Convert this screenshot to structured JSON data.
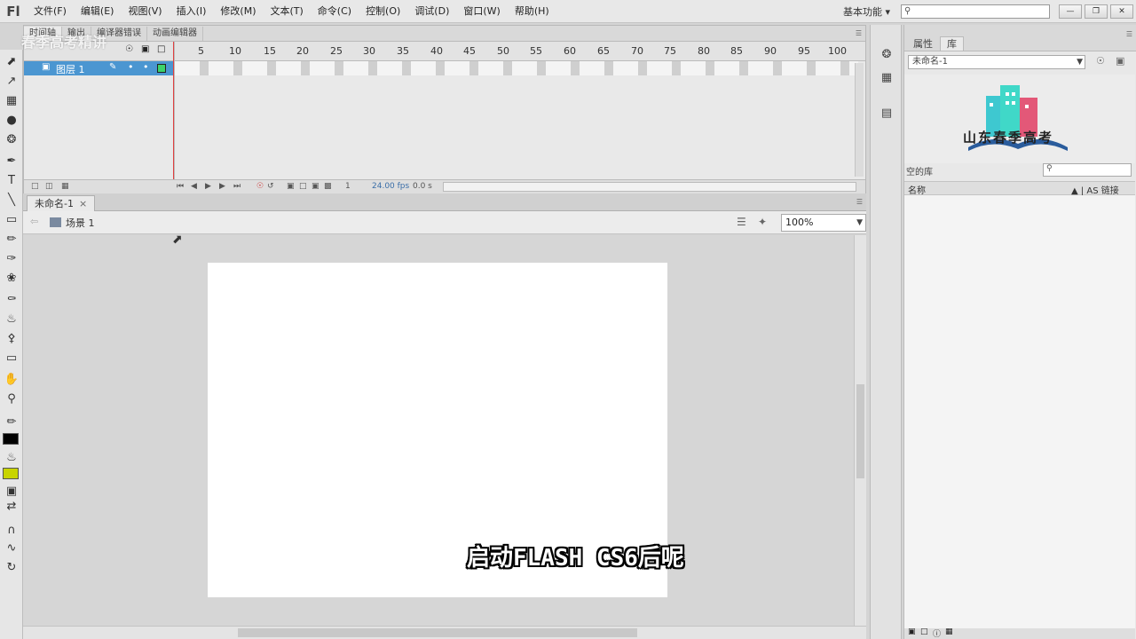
{
  "app": {
    "logo": "Fl",
    "menu": [
      "文件(F)",
      "编辑(E)",
      "视图(V)",
      "插入(I)",
      "修改(M)",
      "文本(T)",
      "命令(C)",
      "控制(O)",
      "调试(D)",
      "窗口(W)",
      "帮助(H)"
    ],
    "workspace": "基本功能",
    "workspace_arrow": "▾",
    "search_placeholder": ""
  },
  "timeline": {
    "tabs": [
      "时间轴",
      "输出",
      "编译器错误",
      "动画编辑器"
    ],
    "frame_numbers": [
      "5",
      "10",
      "15",
      "20",
      "25",
      "30",
      "35",
      "40",
      "45",
      "50",
      "55",
      "60",
      "65",
      "70",
      "75",
      "80",
      "85",
      "90",
      "95",
      "100"
    ],
    "layer_name": "图层 1",
    "current_frame": "1",
    "fps": "24.00 fps",
    "time": "0.0 s"
  },
  "document": {
    "tab_name": "未命名-1",
    "close": "×",
    "scene": "场景 1",
    "zoom": "100%"
  },
  "overlay": {
    "watermark": "春季高考精讲",
    "subtitle": "启动FLASH CS6后呢"
  },
  "right_panel": {
    "tabs": [
      "属性",
      "库"
    ],
    "doc_selector": "未命名-1",
    "logo_text": "山东春季高考",
    "library_status": "空的库",
    "col_name": "名称",
    "col_linkage": "AS 链接"
  },
  "colors": {
    "selected_layer": "#4b96d1",
    "fill_swatch": "#c8d400",
    "stroke_swatch": "#000000"
  }
}
